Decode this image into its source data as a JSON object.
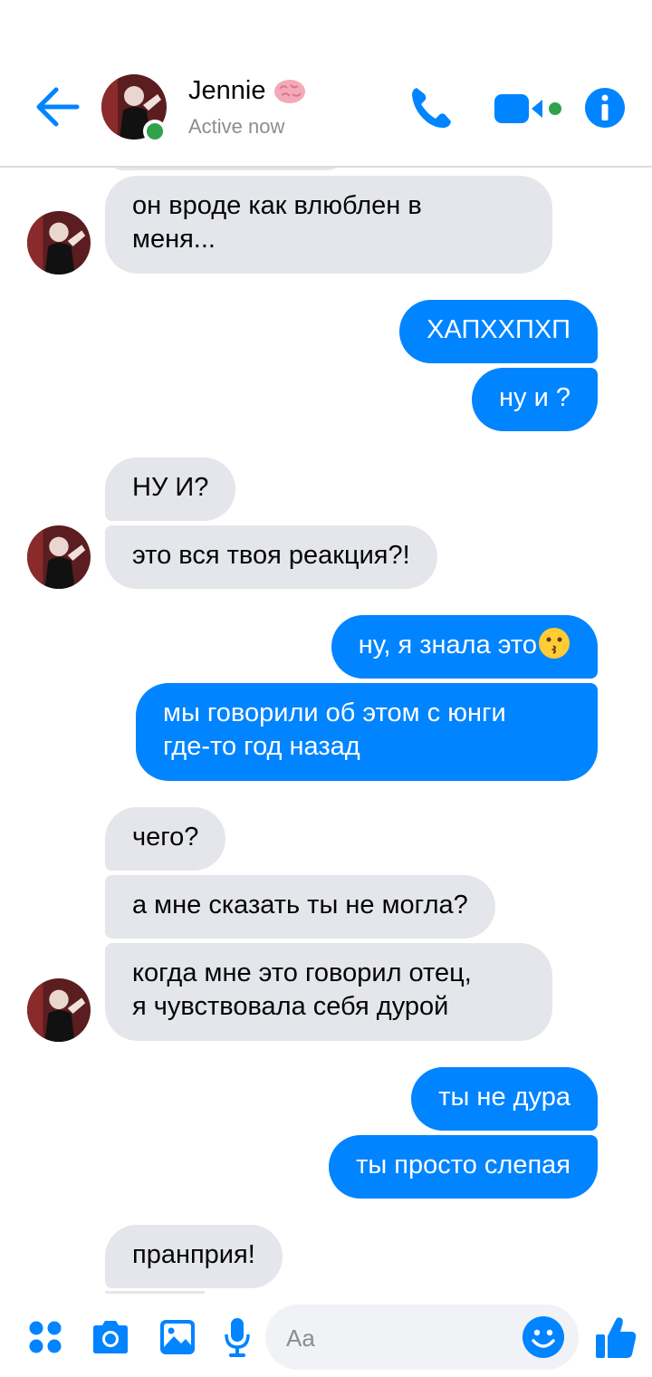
{
  "header": {
    "contact_name": "Jennie",
    "status": "Active now",
    "accent": "#0084ff",
    "online_color": "#31a24c",
    "icons": [
      "back-arrow-icon",
      "brain-icon",
      "phone-icon",
      "video-camera-icon",
      "info-icon"
    ]
  },
  "messages": [
    {
      "dir": "in",
      "text": "он вроде как влюблен в\nменя..."
    },
    {
      "dir": "out",
      "text": "ХАПХХПХП"
    },
    {
      "dir": "out",
      "text": "ну и ?"
    },
    {
      "dir": "in",
      "text": "НУ И?"
    },
    {
      "dir": "in",
      "text": "это вся твоя реакция?!"
    },
    {
      "dir": "out",
      "text": "ну, я знала это",
      "emoji": "kissing-face-icon"
    },
    {
      "dir": "out",
      "text": "мы говорили об этом с юнги\nгде-то год назад"
    },
    {
      "dir": "in",
      "text": "чего?"
    },
    {
      "dir": "in",
      "text": "а мне сказать ты не могла?"
    },
    {
      "dir": "in",
      "text": "когда мне это говорил отец,\nя чувствовала себя дурой"
    },
    {
      "dir": "out",
      "text": "ты не дура"
    },
    {
      "dir": "out",
      "text": "ты просто слепая"
    },
    {
      "dir": "in",
      "text": "пранприя!"
    }
  ],
  "composer": {
    "placeholder": "Aa",
    "icons": [
      "apps-grid-icon",
      "camera-icon",
      "gallery-icon",
      "microphone-icon",
      "emoji-smiley-icon",
      "thumbs-up-icon"
    ]
  }
}
